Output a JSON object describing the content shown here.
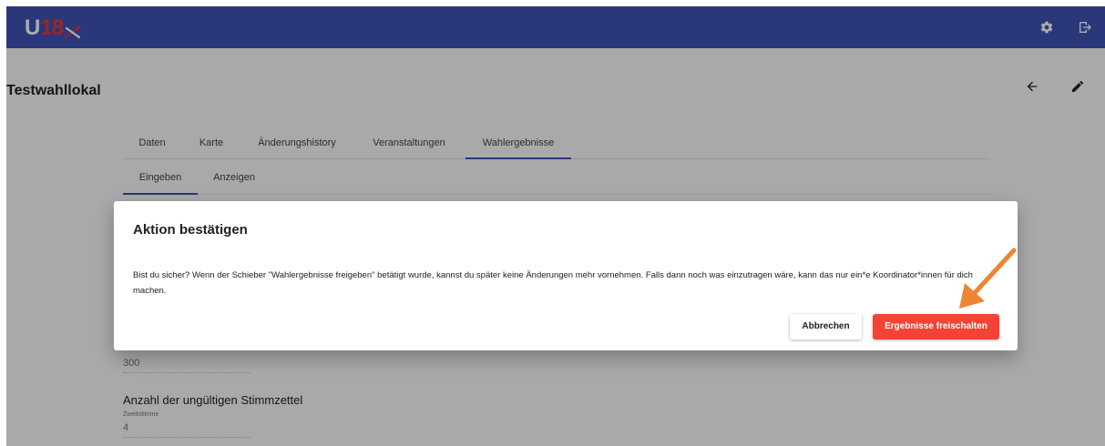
{
  "header": {
    "logo_u": "U",
    "logo_number": "18",
    "settings_icon": "gear-icon",
    "logout_icon": "logout-icon"
  },
  "page": {
    "title": "Testwahllokal",
    "back_icon": "arrow-left-icon",
    "edit_icon": "pencil-icon"
  },
  "tabs": [
    "Daten",
    "Karte",
    "Änderungshistory",
    "Veranstaltungen",
    "Wahlergebnisse"
  ],
  "subtabs": [
    "Eingeben",
    "Anzeigen"
  ],
  "form": {
    "field1_value": "300",
    "section_heading": "Anzahl der ungültigen Stimmzettel",
    "field2_label": "Zweitstimme",
    "field2_value": "4"
  },
  "dialog": {
    "title": "Aktion bestätigen",
    "text": "Bist du sicher? Wenn der Schieber \"Wahlergebnisse freigeben\" betätigt wurde, kannst du später keine Änderungen mehr vornehmen. Falls dann noch was einzutragen wäre, kann das nur ein*e Koordinator*innen für dich machen.",
    "cancel_label": "Abbrechen",
    "confirm_label": "Ergebnisse freischalten"
  },
  "colors": {
    "primary": "#3f51b5",
    "accent_red": "#f44336",
    "annotation_arrow": "#ef8433"
  }
}
